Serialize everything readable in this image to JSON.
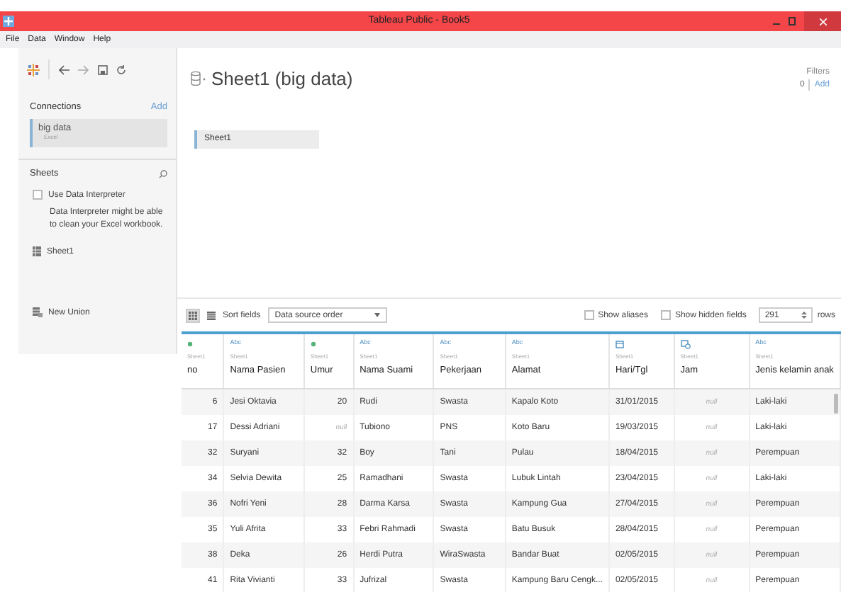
{
  "window": {
    "title": "Tableau Public - Book5"
  },
  "menu": [
    "File",
    "Data",
    "Window",
    "Help"
  ],
  "sidebar": {
    "connections_label": "Connections",
    "add": "Add",
    "connections": [
      {
        "name": "big data",
        "type": "Excel",
        "selected": true
      }
    ],
    "sheets_label": "Sheets",
    "interpreter": {
      "label": "Use Data Interpreter",
      "checked": false
    },
    "hint": "Data Interpreter might be able to clean your Excel workbook.",
    "sheets": [
      "Sheet1"
    ],
    "new_union": "New Union"
  },
  "canvas": {
    "title": "Sheet1 (big data)",
    "filters_label": "Filters",
    "filters_count": "0",
    "filters_add": "Add",
    "tables": [
      "Sheet1"
    ]
  },
  "toolbar": {
    "views": [
      {
        "kind": "grid",
        "selected": true
      },
      {
        "kind": "list",
        "selected": false
      }
    ],
    "sort_label": "Sort fields",
    "sort_value": "Data source order",
    "options": [
      {
        "label": "Show aliases",
        "checked": false
      },
      {
        "label": "Show hidden fields",
        "checked": false
      }
    ],
    "rows_value": "291",
    "rows_label": "rows"
  },
  "grid": {
    "columns": [
      {
        "kind": "number",
        "source": "Sheet1",
        "name": "no"
      },
      {
        "kind": "string",
        "type_label": "Abc",
        "source": "Sheet1",
        "name": "Nama Pasien"
      },
      {
        "kind": "number",
        "source": "Sheet1",
        "name": "Umur"
      },
      {
        "kind": "string",
        "type_label": "Abc",
        "source": "Sheet1",
        "name": "Nama Suami"
      },
      {
        "kind": "string",
        "type_label": "Abc",
        "source": "Sheet1",
        "name": "Pekerjaan"
      },
      {
        "kind": "string",
        "type_label": "Abc",
        "source": "Sheet1",
        "name": "Alamat"
      },
      {
        "kind": "date",
        "source": "Sheet1",
        "name": "Hari/Tgl"
      },
      {
        "kind": "datetime",
        "source": "Sheet1",
        "name": "Jam"
      },
      {
        "kind": "string",
        "type_label": "Abc",
        "source": "Sheet1",
        "name": "Jenis kelamin anak"
      }
    ],
    "rows": [
      [
        "6",
        "Jesi Oktavia",
        "20",
        "Rudi",
        "Swasta",
        "Kapalo Koto",
        "31/01/2015",
        {
          "kind": "null",
          "text": "null"
        },
        "Laki-laki"
      ],
      [
        "17",
        "Dessi Adriani",
        {
          "kind": "null",
          "text": "null"
        },
        "Tubiono",
        "PNS",
        "Koto Baru",
        "19/03/2015",
        {
          "kind": "null",
          "text": "null"
        },
        "Laki-laki"
      ],
      [
        "32",
        "Suryani",
        "32",
        "Boy",
        "Tani",
        "Pulau",
        "18/04/2015",
        {
          "kind": "null",
          "text": "null"
        },
        "Perempuan"
      ],
      [
        "34",
        "Selvia Dewita",
        "25",
        "Ramadhani",
        "Swasta",
        "Lubuk Lintah",
        "23/04/2015",
        {
          "kind": "null",
          "text": "null"
        },
        "Laki-laki"
      ],
      [
        "36",
        "Nofri Yeni",
        "28",
        "Darma Karsa",
        "Swasta",
        "Kampung Gua",
        "27/04/2015",
        {
          "kind": "null",
          "text": "null"
        },
        "Perempuan"
      ],
      [
        "35",
        "Yuli Afrita",
        "33",
        "Febri Rahmadi",
        "Swasta",
        "Batu Busuk",
        "28/04/2015",
        {
          "kind": "null",
          "text": "null"
        },
        "Perempuan"
      ],
      [
        "38",
        "Deka",
        "26",
        "Herdi Putra",
        "WiraSwasta",
        "Bandar Buat",
        "02/05/2015",
        {
          "kind": "null",
          "text": "null"
        },
        "Perempuan"
      ],
      [
        "41",
        "Rita Vivianti",
        "33",
        "Jufrizal",
        "Swasta",
        "Kampung Baru Cengk...",
        "02/05/2015",
        {
          "kind": "null",
          "text": "null"
        },
        "Perempuan"
      ]
    ]
  }
}
